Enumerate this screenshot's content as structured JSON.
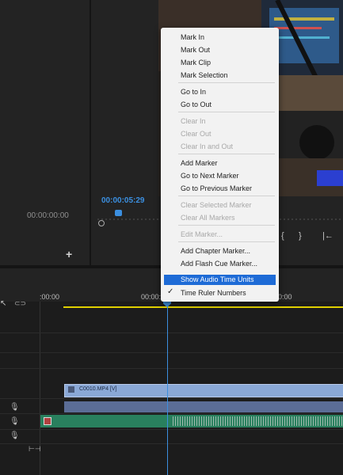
{
  "source": {
    "timecode_left": "00:00:00:00",
    "playhead_timecode": "00:00:05:29",
    "add_button": "+"
  },
  "transport": {
    "icons": [
      "brace-left-icon",
      "brace-right-icon",
      "step-back-icon"
    ],
    "glyphs": [
      "{",
      "}",
      "|←"
    ]
  },
  "timeline": {
    "ruler_labels": [
      ":00:00",
      "00:00:0",
      "00:00"
    ],
    "tool_glyph": "⊂⊃",
    "clip_v1_label": "C0010.MP4 [V]",
    "audio_track_icons": [
      "mic-icon",
      "mic-icon",
      "mic-icon"
    ],
    "transition_glyph": "⊢⊣"
  },
  "context_menu": {
    "items": [
      {
        "label": "Mark In",
        "enabled": true
      },
      {
        "label": "Mark Out",
        "enabled": true
      },
      {
        "label": "Mark Clip",
        "enabled": true
      },
      {
        "label": "Mark Selection",
        "enabled": true
      },
      {
        "label": "Go to In",
        "enabled": true
      },
      {
        "label": "Go to Out",
        "enabled": true
      },
      {
        "label": "Clear In",
        "enabled": false
      },
      {
        "label": "Clear Out",
        "enabled": false
      },
      {
        "label": "Clear In and Out",
        "enabled": false
      },
      {
        "label": "Add Marker",
        "enabled": true
      },
      {
        "label": "Go to Next Marker",
        "enabled": true
      },
      {
        "label": "Go to Previous Marker",
        "enabled": true
      },
      {
        "label": "Clear Selected Marker",
        "enabled": false
      },
      {
        "label": "Clear All Markers",
        "enabled": false
      },
      {
        "label": "Edit Marker...",
        "enabled": false
      },
      {
        "label": "Add Chapter Marker...",
        "enabled": true
      },
      {
        "label": "Add Flash Cue Marker...",
        "enabled": true
      },
      {
        "label": "Show Audio Time Units",
        "enabled": true,
        "highlighted": true
      },
      {
        "label": "Time Ruler Numbers",
        "enabled": true,
        "checked": true
      }
    ]
  },
  "colors": {
    "accent": "#3b8fe0",
    "highlight": "#1e6bd6",
    "video_clip": "#8aa8d6",
    "audio_clip": "#29805e",
    "work_area": "#e0d000"
  }
}
